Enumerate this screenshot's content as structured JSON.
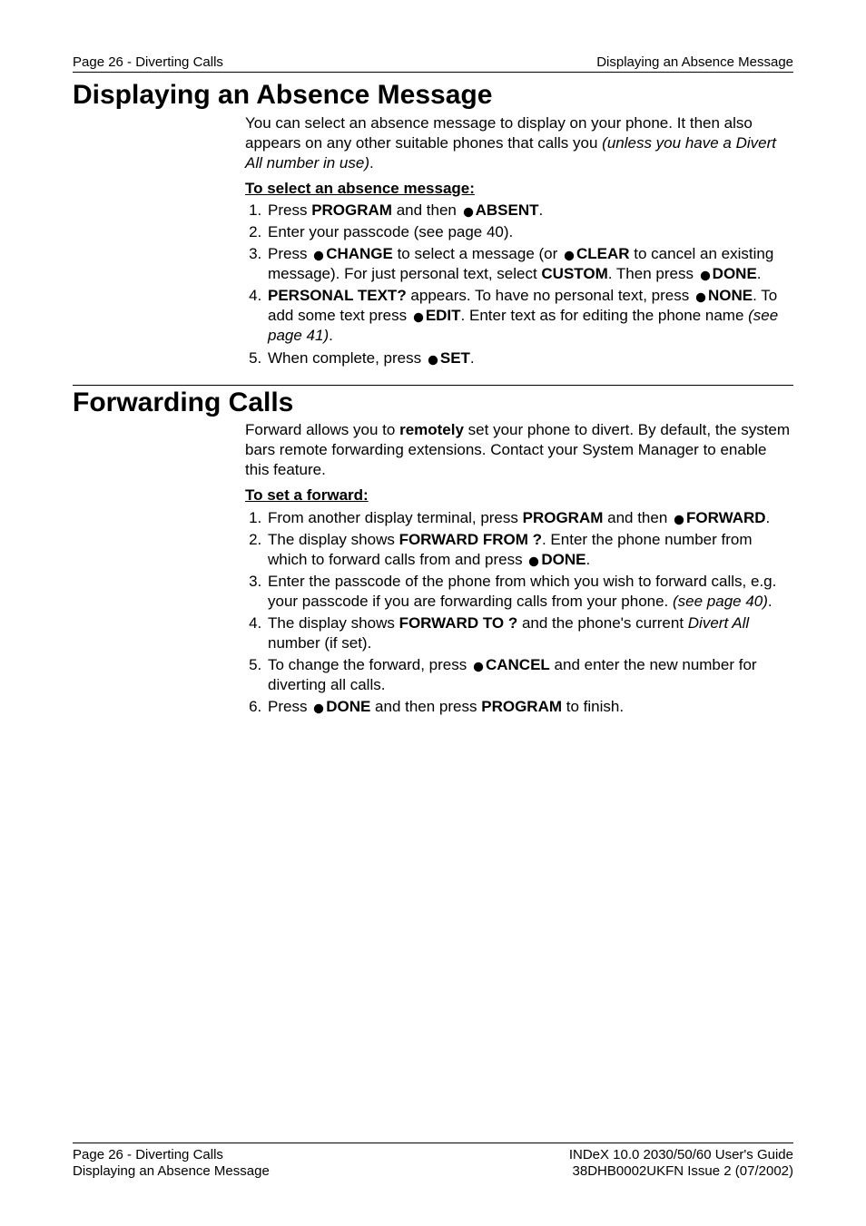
{
  "header": {
    "left": "Page 26 - Diverting Calls",
    "right": "Displaying an Absence Message"
  },
  "sections": [
    {
      "title": "Displaying an Absence Message",
      "intro_parts": [
        {
          "t": "You can select an absence message to display on your phone. It then also appears on any other suitable phones that calls you "
        },
        {
          "t": "(unless you have a Divert All number in use)",
          "i": true
        },
        {
          "t": "."
        }
      ],
      "subhead": "To select an absence message:",
      "steps": [
        [
          {
            "t": "Press "
          },
          {
            "t": "PROGRAM",
            "b": true
          },
          {
            "t": " and then "
          },
          {
            "bullet": true
          },
          {
            "t": "ABSENT",
            "b": true
          },
          {
            "t": "."
          }
        ],
        [
          {
            "t": "Enter your passcode (see page 40)."
          }
        ],
        [
          {
            "t": "Press "
          },
          {
            "bullet": true
          },
          {
            "t": "CHANGE",
            "b": true
          },
          {
            "t": " to select a message (or "
          },
          {
            "bullet": true
          },
          {
            "t": "CLEAR",
            "b": true
          },
          {
            "t": " to cancel an existing message). For just personal text, select "
          },
          {
            "t": "CUSTOM",
            "b": true
          },
          {
            "t": ". Then press "
          },
          {
            "bullet": true
          },
          {
            "t": "DONE",
            "b": true
          },
          {
            "t": "."
          }
        ],
        [
          {
            "t": "PERSONAL TEXT?",
            "b": true
          },
          {
            "t": " appears. To have no personal text, press "
          },
          {
            "bullet": true
          },
          {
            "t": "NONE",
            "b": true
          },
          {
            "t": ". To add some text press "
          },
          {
            "bullet": true
          },
          {
            "t": "EDIT",
            "b": true
          },
          {
            "t": ". Enter text as for editing the phone name "
          },
          {
            "t": "(see page 41)",
            "i": true
          },
          {
            "t": "."
          }
        ],
        [
          {
            "t": "When complete, press "
          },
          {
            "bullet": true
          },
          {
            "t": "SET",
            "b": true
          },
          {
            "t": "."
          }
        ]
      ]
    },
    {
      "title": "Forwarding Calls",
      "intro_parts": [
        {
          "t": "Forward allows you to "
        },
        {
          "t": "remotely",
          "b": true
        },
        {
          "t": " set your phone to divert. By default, the system bars remote forwarding extensions. Contact your System Manager to enable this feature."
        }
      ],
      "subhead": "To set a forward:",
      "steps": [
        [
          {
            "t": "From another  display terminal, press "
          },
          {
            "t": "PROGRAM",
            "b": true
          },
          {
            "t": " and then "
          },
          {
            "bullet": true
          },
          {
            "t": "FORWARD",
            "b": true
          },
          {
            "t": "."
          }
        ],
        [
          {
            "t": "The display shows "
          },
          {
            "t": "FORWARD FROM ?",
            "b": true
          },
          {
            "t": ". Enter the phone number from which to forward calls from and press "
          },
          {
            "bullet": true
          },
          {
            "t": "DONE",
            "b": true
          },
          {
            "t": "."
          }
        ],
        [
          {
            "t": "Enter the passcode of the phone from which you wish to forward calls, e.g. your passcode if you are forwarding calls from your phone. "
          },
          {
            "t": "(see page 40)",
            "i": true
          },
          {
            "t": "."
          }
        ],
        [
          {
            "t": "The display shows "
          },
          {
            "t": "FORWARD TO ?",
            "b": true
          },
          {
            "t": " and the phone's current "
          },
          {
            "t": "Divert All",
            "i": true
          },
          {
            "t": " number (if set)."
          }
        ],
        [
          {
            "t": "To change the forward, press "
          },
          {
            "bullet": true
          },
          {
            "t": "CANCEL",
            "b": true
          },
          {
            "t": " and enter the new number for diverting all calls."
          }
        ],
        [
          {
            "t": "Press "
          },
          {
            "bullet": true
          },
          {
            "t": "DONE",
            "b": true
          },
          {
            "t": " and then press "
          },
          {
            "t": "PROGRAM",
            "b": true
          },
          {
            "t": " to finish."
          }
        ]
      ]
    }
  ],
  "footer": {
    "left1": "Page 26 - Diverting Calls",
    "left2": "Displaying an Absence Message",
    "right1": "INDeX 10.0 2030/50/60 User's Guide",
    "right2": "38DHB0002UKFN Issue 2 (07/2002)"
  }
}
